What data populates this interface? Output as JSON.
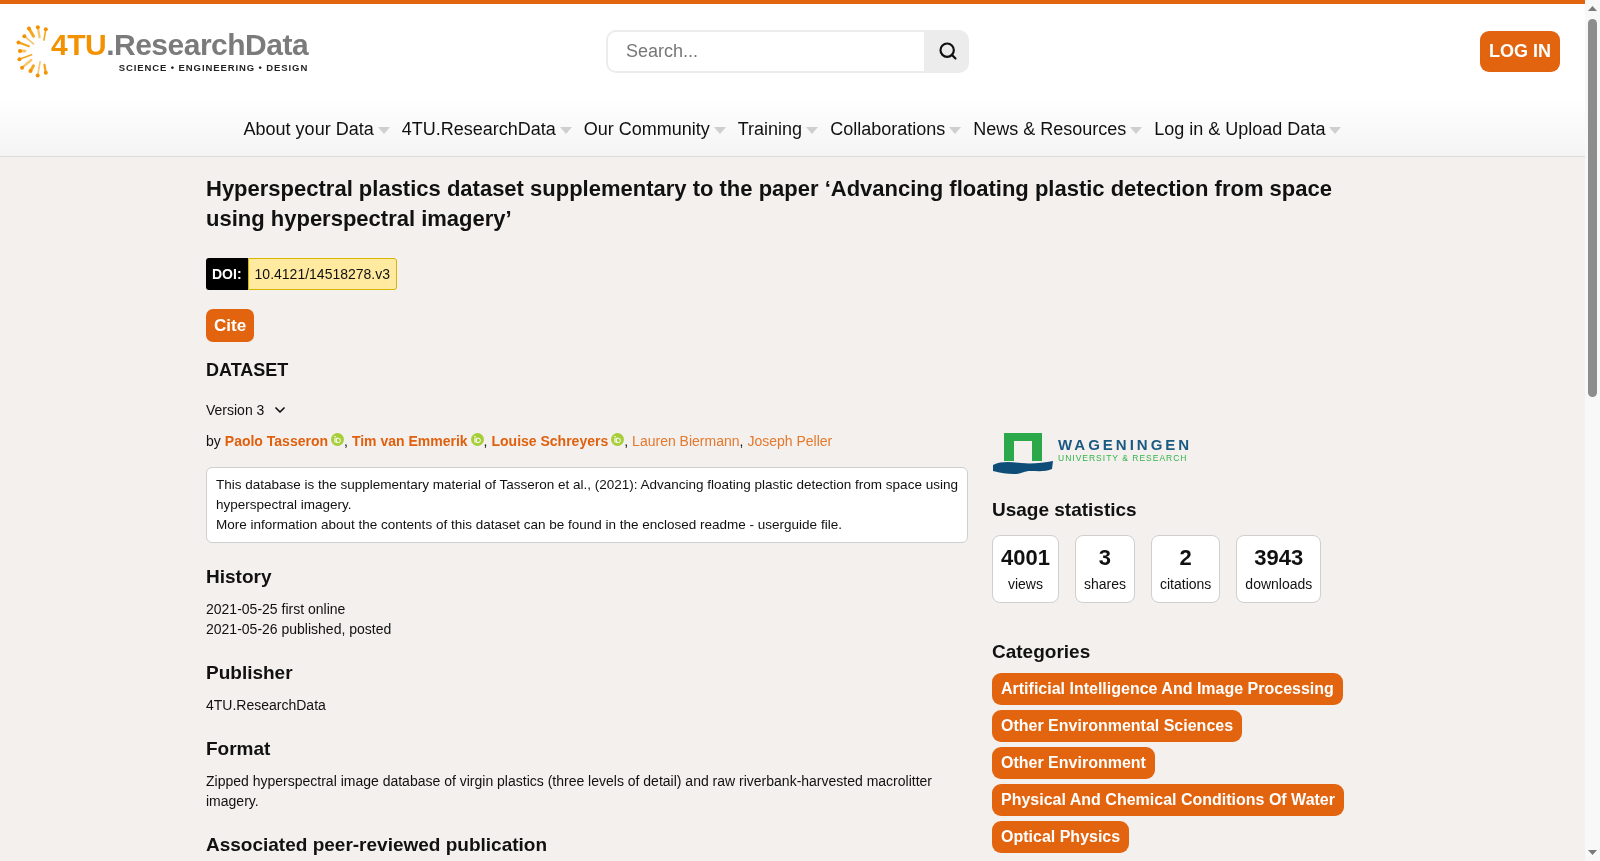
{
  "header": {
    "logo": {
      "mark": "4TU",
      "name": ".ResearchData",
      "tagline": "SCIENCE • ENGINEERING • DESIGN"
    },
    "search": {
      "placeholder": "Search..."
    },
    "login_button": "LOG IN"
  },
  "nav": [
    "About your Data",
    "4TU.ResearchData",
    "Our Community",
    "Training",
    "Collaborations",
    "News & Resources",
    "Log in & Upload Data"
  ],
  "dataset": {
    "title": "Hyperspectral plastics dataset supplementary to the paper ‘Advancing floating plastic detection from space using hyperspectral imagery’",
    "doi": {
      "label": "DOI:",
      "value": "10.4121/14518278.v3"
    },
    "cite_button": "Cite",
    "type_label": "DATASET",
    "version": "Version 3",
    "by": "by",
    "authors": [
      {
        "name": "Paolo Tasseron",
        "orcid": true,
        "separator": ","
      },
      {
        "name": "Tim van Emmerik",
        "orcid": true,
        "separator": ","
      },
      {
        "name": "Louise Schreyers",
        "orcid": true,
        "separator": ","
      },
      {
        "name": "Lauren Biermann",
        "orcid": false,
        "separator": ","
      },
      {
        "name": "Joseph Peller",
        "orcid": false
      }
    ],
    "description": [
      "This database is the supplementary material of Tasseron et al., (2021): Advancing floating plastic detection from space using hyperspectral imagery.",
      "More information about the contents of this dataset can be found in the enclosed readme - userguide file."
    ],
    "sections": [
      {
        "heading": "History",
        "lines": [
          "2021-05-25 first online",
          "2021-05-26 published, posted"
        ]
      },
      {
        "heading": "Publisher",
        "lines": [
          "4TU.ResearchData"
        ]
      },
      {
        "heading": "Format",
        "lines": [
          "Zipped hyperspectral image database of virgin plastics (three levels of detail) and raw riverbank-harvested macrolitter imagery."
        ]
      },
      {
        "heading": "Associated peer-reviewed publication"
      }
    ]
  },
  "sidebar": {
    "partner_logo": {
      "name": "WAGENINGEN",
      "subtitle": "UNIVERSITY & RESEARCH"
    },
    "usage": {
      "heading": "Usage statistics",
      "stats": [
        {
          "value": "4001",
          "label": "views"
        },
        {
          "value": "3",
          "label": "shares"
        },
        {
          "value": "2",
          "label": "citations"
        },
        {
          "value": "3943",
          "label": "downloads"
        }
      ]
    },
    "categories": {
      "heading": "Categories",
      "items": [
        "Artificial Intelligence And Image Processing",
        "Other Environmental Sciences",
        "Other Environment",
        "Physical And Chemical Conditions Of Water",
        "Optical Physics"
      ]
    }
  }
}
